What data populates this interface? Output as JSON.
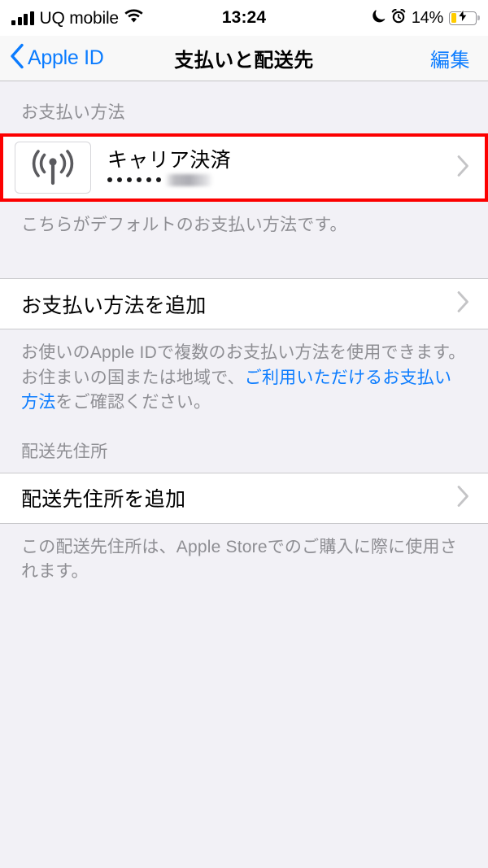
{
  "status_bar": {
    "carrier": "UQ mobile",
    "signal_bars": 4,
    "signal_icon": "cellular-signal-icon",
    "wifi_icon": "wifi-icon",
    "time": "13:24",
    "dnd_icon": "moon-icon",
    "alarm_icon": "alarm-clock-icon",
    "battery_percent": "14%",
    "battery_level": 14,
    "battery_charging": true,
    "battery_fill_color": "#ffcc00",
    "battery_icon": "battery-charging-icon"
  },
  "nav_bar": {
    "back_icon": "chevron-left-icon",
    "back_label": "Apple ID",
    "title": "支払いと配送先",
    "edit_label": "編集",
    "tint_color": "#0b7cff"
  },
  "payment_section": {
    "header": "お支払い方法",
    "highlight_color": "#fc0000",
    "method": {
      "icon": "antenna-broadcast-icon",
      "title": "キャリア決済",
      "masked_dots": 6,
      "masked_value_redacted": true,
      "chevron_icon": "chevron-right-icon"
    },
    "footer": "こちらがデフォルトのお支払い方法です。",
    "add_row": {
      "label": "お支払い方法を追加",
      "chevron_icon": "chevron-right-icon"
    },
    "add_footer": {
      "part1": "お使いのApple IDで複数のお支払い方法を使用できます。お住まいの国または地域で、",
      "link": "ご利用いただけるお支払い方法",
      "part2": "をご確認ください。",
      "link_color": "#0b7cff"
    }
  },
  "shipping_section": {
    "header": "配送先住所",
    "add_row": {
      "label": "配送先住所を追加",
      "chevron_icon": "chevron-right-icon"
    },
    "footer": "この配送先住所は、Apple Storeでのご購入に際に使用されます。"
  }
}
